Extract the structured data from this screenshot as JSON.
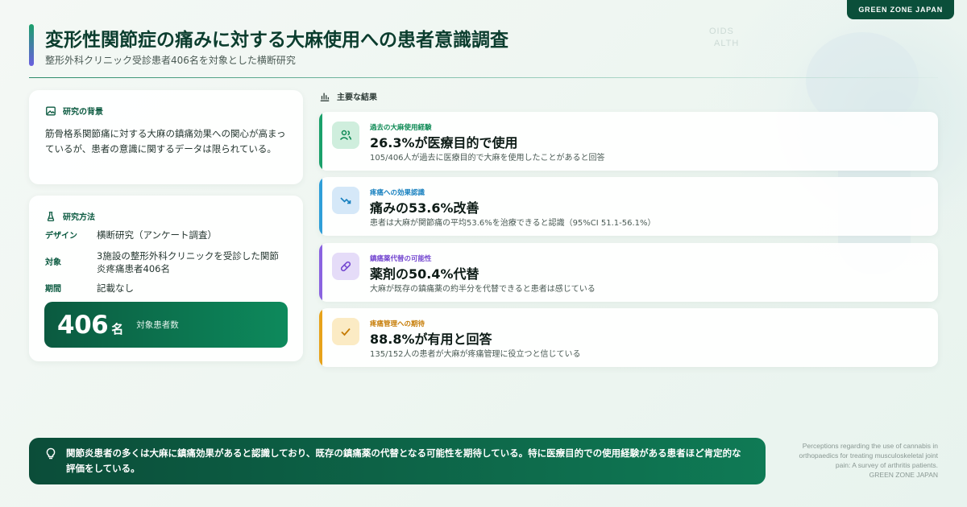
{
  "brand": "GREEN ZONE JAPAN",
  "background_watermark": [
    "OIDS",
    "ALTH"
  ],
  "header": {
    "title": "変形性関節症の痛みに対する大麻使用への患者意識調査",
    "subtitle": "整形外科クリニック受診患者406名を対象とした横断研究"
  },
  "background": {
    "heading": "研究の背景",
    "icon": "image-icon",
    "text": "筋骨格系関節痛に対する大麻の鎮痛効果への関心が高まっているが、患者の意識に関するデータは限られている。"
  },
  "methods": {
    "heading": "研究方法",
    "icon": "flask-icon",
    "rows": [
      {
        "key": "デザイン",
        "value": "横断研究（アンケート調査）"
      },
      {
        "key": "対象",
        "value": "3施設の整形外科クリニックを受診した関節炎疼痛患者406名"
      },
      {
        "key": "期間",
        "value": "記載なし"
      }
    ],
    "count": {
      "number": "406",
      "unit": "名",
      "label": "対象患者数"
    }
  },
  "results": {
    "heading": "主要な結果",
    "icon": "bar-chart-icon",
    "items": [
      {
        "label": "過去の大麻使用経験",
        "value": "26.3%が医療目的で使用",
        "desc": "105/406人が過去に医療目的で大麻を使用したことがあると回答",
        "icon": "users-icon",
        "color": "#1aa06a"
      },
      {
        "label": "疼痛への効果認識",
        "value": "痛みの53.6%改善",
        "desc": "患者は大麻が関節痛の平均53.6%を治療できると認識（95%CI 51.1-56.1%）",
        "icon": "trend-down-icon",
        "color": "#2f9ed8"
      },
      {
        "label": "鎮痛薬代替の可能性",
        "value": "薬剤の50.4%代替",
        "desc": "大麻が既存の鎮痛薬の約半分を代替できると患者は感じている",
        "icon": "pill-icon",
        "color": "#8a63e0"
      },
      {
        "label": "疼痛管理への期待",
        "value": "88.8%が有用と回答",
        "desc": "135/152人の患者が大麻が疼痛管理に役立つと信じている",
        "icon": "check-icon",
        "color": "#e7a21a"
      }
    ]
  },
  "conclusion": {
    "icon": "lightbulb-icon",
    "text": "関節炎患者の多くは大麻に鎮痛効果があると認識しており、既存の鎮痛薬の代替となる可能性を期待している。特に医療目的での使用経験がある患者ほど肯定的な評価をしている。"
  },
  "source": {
    "line1": "Perceptions regarding the use of cannabis in",
    "line2": "orthopaedics for treating musculoskeletal joint",
    "line3": "pain: A survey of arthritis patients.",
    "line4": "GREEN ZONE JAPAN"
  }
}
